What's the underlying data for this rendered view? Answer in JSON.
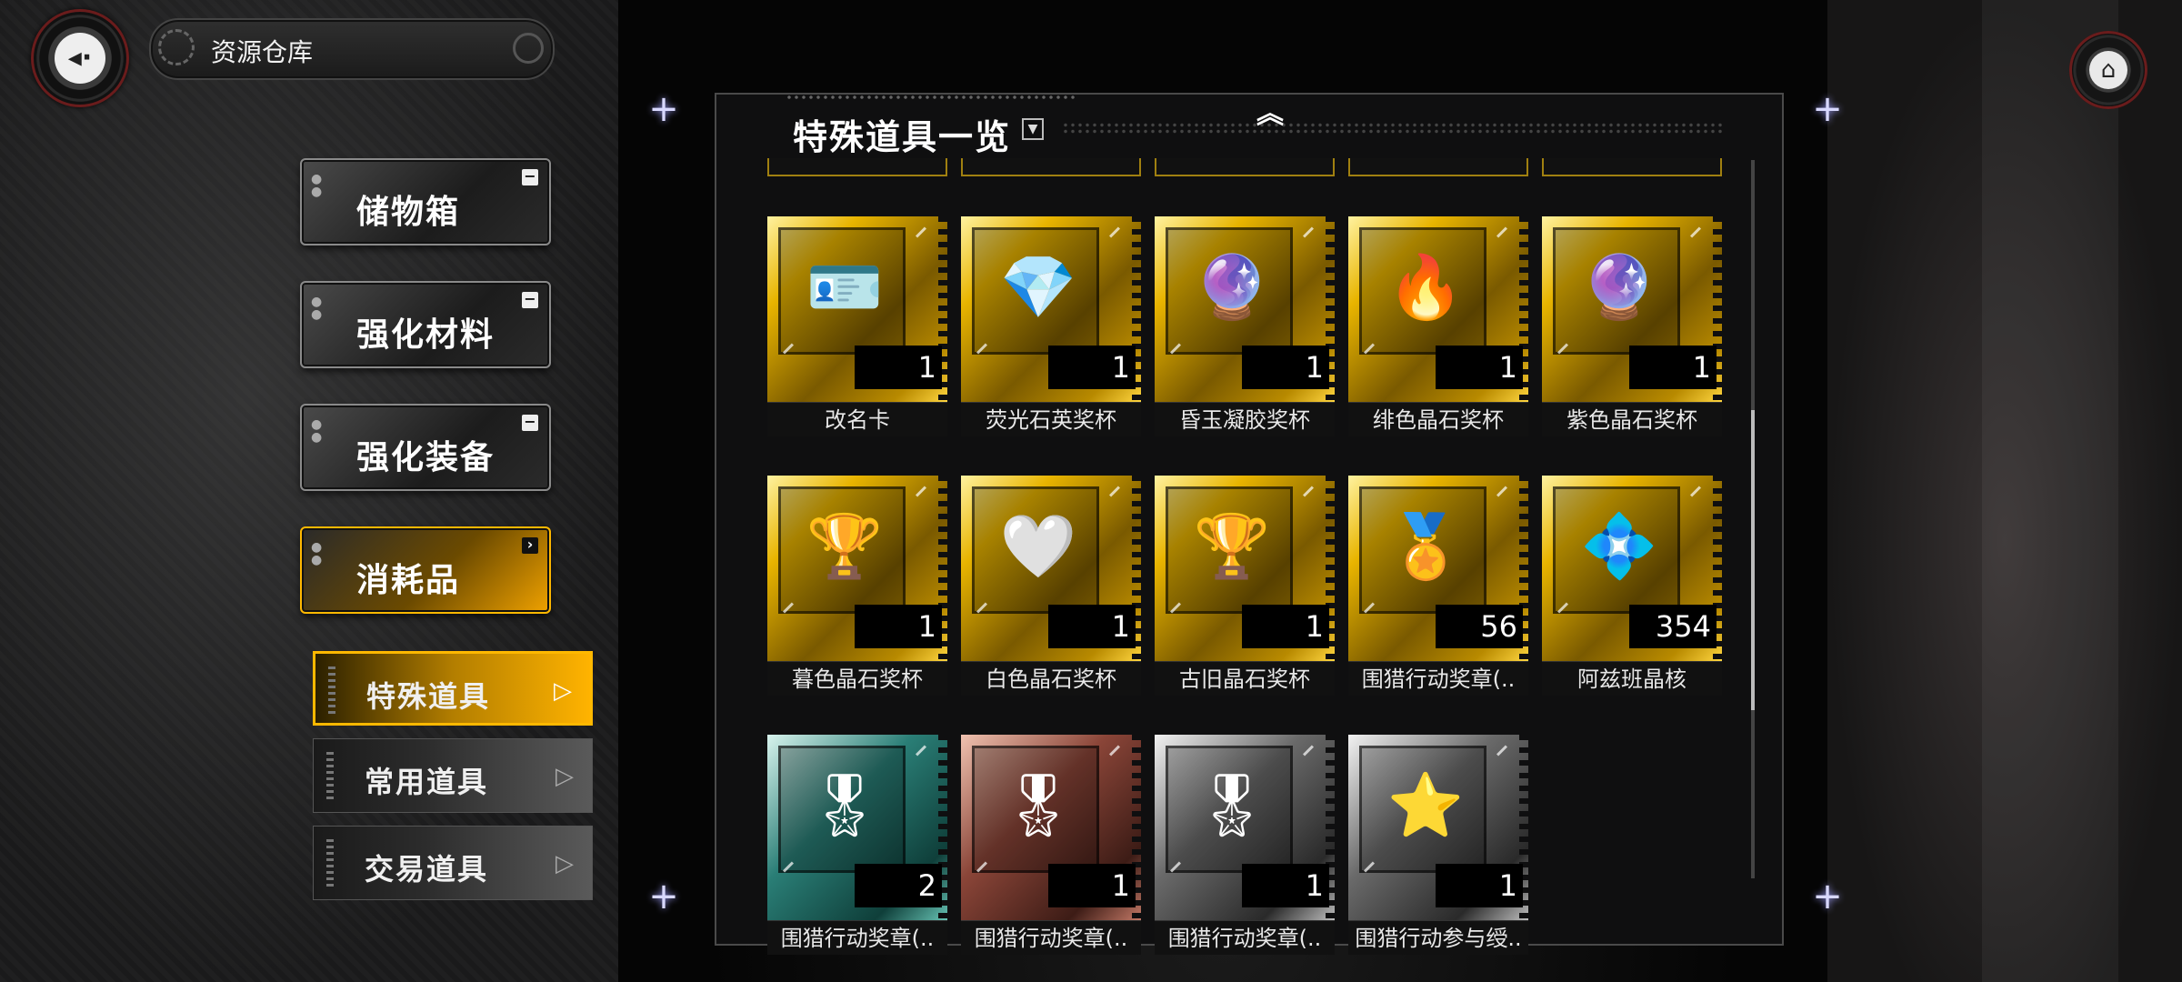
{
  "header": {
    "title": "资源仓库",
    "back_icon": "back-arrow-icon",
    "home_icon": "home-icon"
  },
  "categories": [
    {
      "label": "储物箱",
      "tag": "−",
      "active": false
    },
    {
      "label": "强化材料",
      "tag": "−",
      "active": false
    },
    {
      "label": "强化装备",
      "tag": "−",
      "active": false
    },
    {
      "label": "消耗品",
      "tag": "›",
      "active": true
    }
  ],
  "subcategories": [
    {
      "label": "特殊道具",
      "active": true
    },
    {
      "label": "常用道具",
      "active": false
    },
    {
      "label": "交易道具",
      "active": false
    }
  ],
  "panel": {
    "title": "特殊道具一览",
    "dropdown_icon": "triangle-down-icon",
    "collapse_icon": "double-chevron-up-icon"
  },
  "items": [
    {
      "name": "改名卡",
      "count": "1",
      "style": "gold",
      "icon": "id-card-icon",
      "glyph": "🪪"
    },
    {
      "name": "荧光石英奖杯",
      "count": "1",
      "style": "gold",
      "icon": "cyan-crystal-trophy-icon",
      "glyph": "💎"
    },
    {
      "name": "昏玉凝胶奖杯",
      "count": "1",
      "style": "gold",
      "icon": "purple-gem-trophy-icon",
      "glyph": "🔮"
    },
    {
      "name": "绯色晶石奖杯",
      "count": "1",
      "style": "gold",
      "icon": "orange-crystal-trophy-icon",
      "glyph": "🔥"
    },
    {
      "name": "紫色晶石奖杯",
      "count": "1",
      "style": "gold",
      "icon": "violet-crystal-trophy-icon",
      "glyph": "🔮"
    },
    {
      "name": "暮色晶石奖杯",
      "count": "1",
      "style": "gold",
      "icon": "dark-crystal-trophy-icon",
      "glyph": "🏆"
    },
    {
      "name": "白色晶石奖杯",
      "count": "1",
      "style": "gold",
      "icon": "white-crystal-trophy-icon",
      "glyph": "🤍"
    },
    {
      "name": "古旧晶石奖杯",
      "count": "1",
      "style": "gold",
      "icon": "black-crystal-trophy-icon",
      "glyph": "🏆"
    },
    {
      "name": "围猎行动奖章(..",
      "count": "56",
      "style": "gold",
      "icon": "gold-laurel-medal-icon",
      "glyph": "🏅"
    },
    {
      "name": "阿兹班晶核",
      "count": "354",
      "style": "gold",
      "icon": "crystal-core-icon",
      "glyph": "💠"
    },
    {
      "name": "围猎行动奖章(..",
      "count": "2",
      "style": "teal",
      "icon": "teal-laurel-medal-icon",
      "glyph": "🎖"
    },
    {
      "name": "围猎行动奖章(..",
      "count": "1",
      "style": "copper",
      "icon": "bronze-laurel-medal-icon",
      "glyph": "🎖"
    },
    {
      "name": "围猎行动奖章(..",
      "count": "1",
      "style": "silver",
      "icon": "silver-laurel-medal-icon",
      "glyph": "🎖"
    },
    {
      "name": "围猎行动参与绶..",
      "count": "1",
      "style": "silver",
      "icon": "ribbon-star-badge-icon",
      "glyph": "⭐"
    }
  ]
}
